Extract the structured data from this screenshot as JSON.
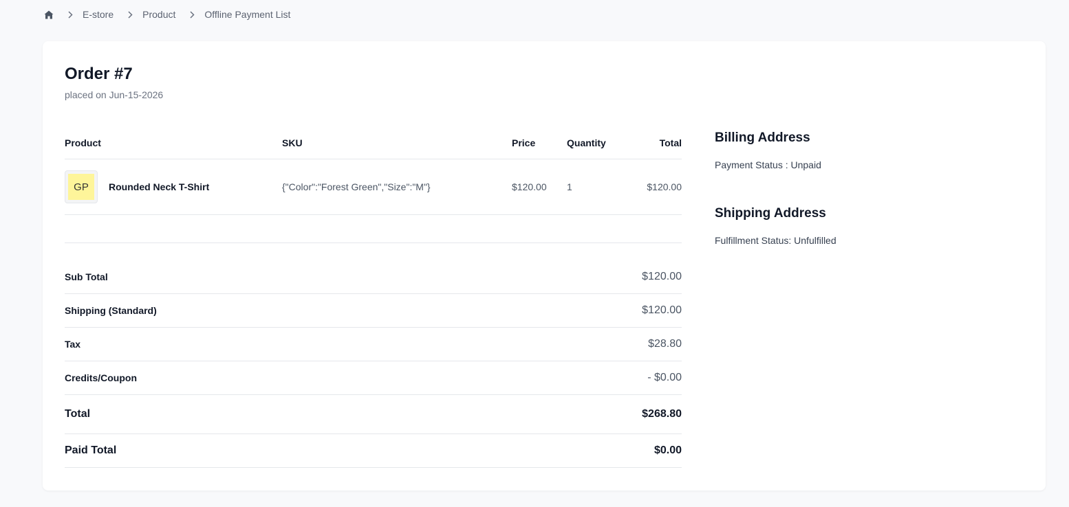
{
  "breadcrumb": {
    "items": [
      "E-store",
      "Product",
      "Offline Payment List"
    ]
  },
  "order": {
    "title": "Order #7",
    "placed": "placed on Jun-15-2026"
  },
  "table": {
    "headers": {
      "product": "Product",
      "sku": "SKU",
      "price": "Price",
      "quantity": "Quantity",
      "total": "Total"
    },
    "rows": [
      {
        "thumb": "GP",
        "name": "Rounded Neck T-Shirt",
        "sku": "{\"Color\":\"Forest Green\",\"Size\":\"M\"}",
        "price": "$120.00",
        "quantity": "1",
        "total": "$120.00"
      }
    ]
  },
  "summary": {
    "subtotal_label": "Sub Total",
    "subtotal_value": "$120.00",
    "shipping_label": "Shipping (Standard)",
    "shipping_value": "$120.00",
    "tax_label": "Tax",
    "tax_value": "$28.80",
    "credits_label": "Credits/Coupon",
    "credits_value": "- $0.00",
    "total_label": "Total",
    "total_value": "$268.80",
    "paid_label": "Paid Total",
    "paid_value": "$0.00"
  },
  "billing": {
    "title": "Billing Address",
    "status": "Payment Status : Unpaid"
  },
  "shipping": {
    "title": "Shipping Address",
    "status": "Fulfillment Status: Unfulfilled"
  },
  "colors": {
    "page_bg": "#f8f9fb",
    "card_bg": "#ffffff",
    "thumb_fill": "#fef59a",
    "divider": "#e5e7eb"
  },
  "icons": {
    "home": "home-icon",
    "separator": "chevron-right-icon"
  }
}
